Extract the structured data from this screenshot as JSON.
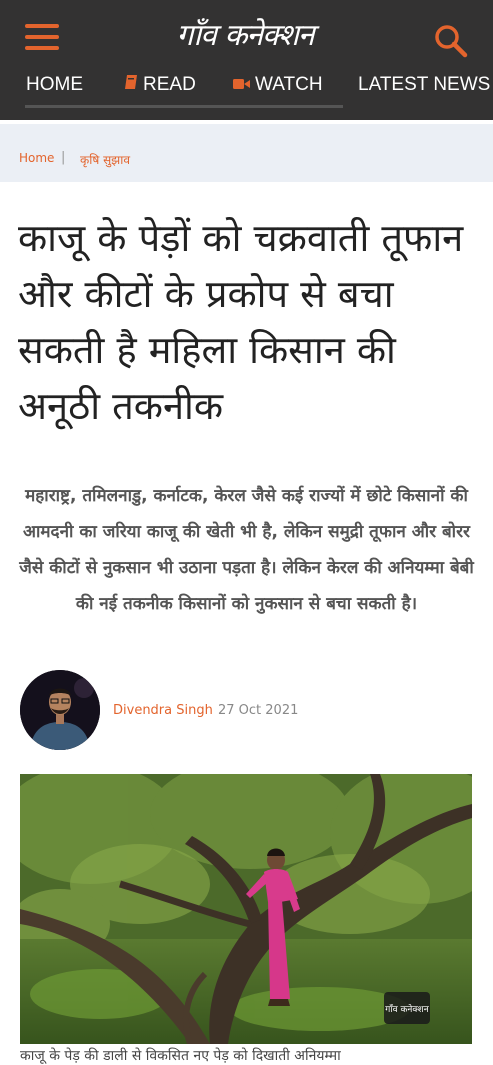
{
  "header": {
    "logo_text": "गाँव कनेक्शन",
    "nav": [
      {
        "label": "HOME"
      },
      {
        "label": "READ"
      },
      {
        "label": "WATCH"
      },
      {
        "label": "LATEST NEWS"
      }
    ]
  },
  "breadcrumb": {
    "home": "Home",
    "separator": "|",
    "category": "कृषि सुझाव"
  },
  "article": {
    "title": "काजू के पेड़ों को चक्रवाती तूफान और कीटों के प्रकोप से बचा सकती है महिला किसान की अनूठी तकनीक",
    "summary": "महाराष्ट्र, तमिलनाडु, कर्नाटक, केरल जैसे कई राज्यों में छोटे किसानों की आमदनी का जरिया काजू की खेती भी है, लेकिन समुद्री तूफान और बोरर जैसे कीटों से नुकसान भी उठाना पड़ता है। लेकिन केरल की अनियम्मा बेबी की नई तकनीक किसानों को नुकसान से बचा सकती है।",
    "author": "Divendra Singh",
    "date": "27 Oct 2021",
    "image_watermark": "गाँव कनेक्शन",
    "caption": "काजू के पेड़ की डाली से विकसित नए पेड़ को दिखाती अनियम्मा"
  },
  "colors": {
    "accent": "#e3642d",
    "header_bg": "#333232",
    "breadcrumb_bg": "#ebeff5"
  },
  "icons": {
    "menu": "hamburger-icon",
    "search": "search-icon",
    "read": "book-icon",
    "watch": "video-camera-icon"
  }
}
